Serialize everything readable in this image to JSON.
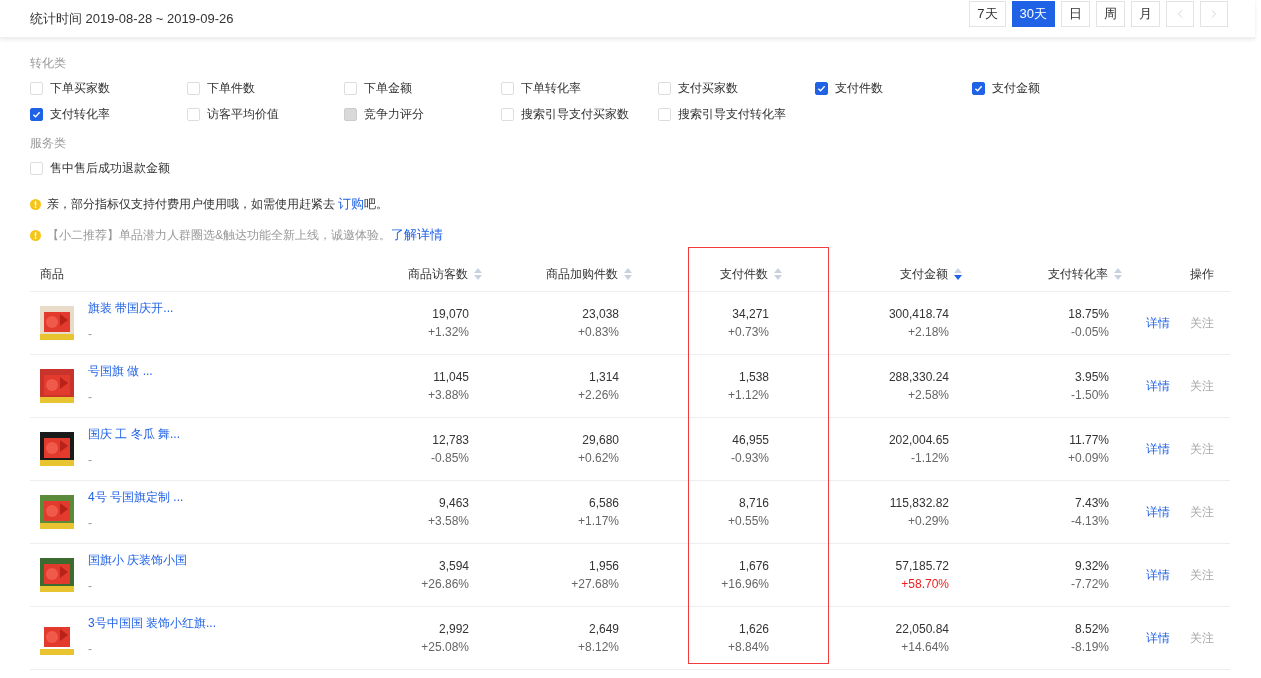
{
  "header": {
    "period_label": "统计时间 2019-08-28 ~ 2019-09-26",
    "ranges": [
      {
        "label": "7天",
        "selected": false
      },
      {
        "label": "30天",
        "selected": true
      },
      {
        "label": "日",
        "selected": false
      },
      {
        "label": "周",
        "selected": false
      },
      {
        "label": "月",
        "selected": false
      }
    ]
  },
  "metric_groups": [
    {
      "title": "转化类",
      "items": [
        {
          "label": "下单买家数",
          "checked": false,
          "disabled": false
        },
        {
          "label": "下单件数",
          "checked": false,
          "disabled": false
        },
        {
          "label": "下单金额",
          "checked": false,
          "disabled": false
        },
        {
          "label": "下单转化率",
          "checked": false,
          "disabled": false
        },
        {
          "label": "支付买家数",
          "checked": false,
          "disabled": false
        },
        {
          "label": "支付件数",
          "checked": true,
          "disabled": false
        },
        {
          "label": "支付金额",
          "checked": true,
          "disabled": false
        },
        {
          "label": "支付转化率",
          "checked": true,
          "disabled": false
        },
        {
          "label": "访客平均价值",
          "checked": false,
          "disabled": false
        },
        {
          "label": "竞争力评分",
          "checked": false,
          "disabled": true
        },
        {
          "label": "搜索引导支付买家数",
          "checked": false,
          "disabled": false
        },
        {
          "label": "搜索引导支付转化率",
          "checked": false,
          "disabled": false
        }
      ]
    },
    {
      "title": "服务类",
      "items": [
        {
          "label": "售中售后成功退款金额",
          "checked": false,
          "disabled": false
        }
      ]
    }
  ],
  "notices": [
    {
      "kind": "notice",
      "text": "亲，部分指标仅支持付费用户使用哦，如需使用赶紧去 ",
      "link": "订购",
      "suffix": "吧。"
    },
    {
      "kind": "tip",
      "text": "【小二推荐】单品潜力人群圈选&触达功能全新上线，诚邀体验。",
      "link": "了解详情"
    }
  ],
  "table": {
    "columns": [
      {
        "label": "商品",
        "sortable": false,
        "highlighted": false
      },
      {
        "label": "商品访客数",
        "sortable": true,
        "sorted_desc": false,
        "highlighted": false
      },
      {
        "label": "商品加购件数",
        "sortable": true,
        "sorted_desc": false,
        "highlighted": false
      },
      {
        "label": "支付件数",
        "sortable": true,
        "sorted_desc": false,
        "highlighted": true
      },
      {
        "label": "支付金额",
        "sortable": true,
        "sorted_desc": true,
        "highlighted": false
      },
      {
        "label": "支付转化率",
        "sortable": true,
        "sorted_desc": false,
        "highlighted": false
      },
      {
        "label": "操作",
        "sortable": false,
        "highlighted": false
      }
    ],
    "rows": [
      {
        "name": "旗装 带国庆开...",
        "sub": "-",
        "metrics": [
          {
            "value": "19,070",
            "change": "+1.32%",
            "alert": false
          },
          {
            "value": "23,038",
            "change": "+0.83%",
            "alert": false
          },
          {
            "value": "34,271",
            "change": "+0.73%",
            "alert": false
          },
          {
            "value": "300,418.74",
            "change": "+2.18%",
            "alert": false
          },
          {
            "value": "18.75%",
            "change": "-0.05%",
            "alert": false
          }
        ],
        "actions": [
          {
            "label": "详情",
            "kind": "link"
          },
          {
            "label": "关注",
            "kind": "muted"
          }
        ]
      },
      {
        "name": "号国旗 做 ...",
        "sub": "-",
        "metrics": [
          {
            "value": "11,045",
            "change": "+3.88%",
            "alert": false
          },
          {
            "value": "1,314",
            "change": "+2.26%",
            "alert": false
          },
          {
            "value": "1,538",
            "change": "+1.12%",
            "alert": false
          },
          {
            "value": "288,330.24",
            "change": "+2.58%",
            "alert": false
          },
          {
            "value": "3.95%",
            "change": "-1.50%",
            "alert": false
          }
        ],
        "actions": [
          {
            "label": "详情",
            "kind": "link"
          },
          {
            "label": "关注",
            "kind": "muted"
          }
        ]
      },
      {
        "name": "国庆 工 冬瓜 舞...",
        "sub": "-",
        "metrics": [
          {
            "value": "12,783",
            "change": "-0.85%",
            "alert": false
          },
          {
            "value": "29,680",
            "change": "+0.62%",
            "alert": false
          },
          {
            "value": "46,955",
            "change": "-0.93%",
            "alert": false
          },
          {
            "value": "202,004.65",
            "change": "-1.12%",
            "alert": false
          },
          {
            "value": "11.77%",
            "change": "+0.09%",
            "alert": false
          }
        ],
        "actions": [
          {
            "label": "详情",
            "kind": "link"
          },
          {
            "label": "关注",
            "kind": "muted"
          }
        ]
      },
      {
        "name": "4号 号国旗定制 ...",
        "sub": "-",
        "metrics": [
          {
            "value": "9,463",
            "change": "+3.58%",
            "alert": false
          },
          {
            "value": "6,586",
            "change": "+1.17%",
            "alert": false
          },
          {
            "value": "8,716",
            "change": "+0.55%",
            "alert": false
          },
          {
            "value": "115,832.82",
            "change": "+0.29%",
            "alert": false
          },
          {
            "value": "7.43%",
            "change": "-4.13%",
            "alert": false
          }
        ],
        "actions": [
          {
            "label": "详情",
            "kind": "link"
          },
          {
            "label": "关注",
            "kind": "muted"
          }
        ]
      },
      {
        "name": "国旗小 庆装饰小国",
        "sub": "-",
        "metrics": [
          {
            "value": "3,594",
            "change": "+26.86%",
            "alert": false
          },
          {
            "value": "1,956",
            "change": "+27.68%",
            "alert": false
          },
          {
            "value": "1,676",
            "change": "+16.96%",
            "alert": false
          },
          {
            "value": "57,185.72",
            "change": "+58.70%",
            "alert": true
          },
          {
            "value": "9.32%",
            "change": "-7.72%",
            "alert": false
          }
        ],
        "actions": [
          {
            "label": "详情",
            "kind": "link"
          },
          {
            "label": "关注",
            "kind": "muted"
          }
        ]
      },
      {
        "name": "3号中国国 装饰小红旗...",
        "sub": "-",
        "metrics": [
          {
            "value": "2,992",
            "change": "+25.08%",
            "alert": false
          },
          {
            "value": "2,649",
            "change": "+8.12%",
            "alert": false
          },
          {
            "value": "1,626",
            "change": "+8.84%",
            "alert": false
          },
          {
            "value": "22,050.84",
            "change": "+14.64%",
            "alert": false
          },
          {
            "value": "8.52%",
            "change": "-8.19%",
            "alert": false
          }
        ],
        "actions": [
          {
            "label": "详情",
            "kind": "link"
          },
          {
            "label": "关注",
            "kind": "muted"
          }
        ]
      }
    ]
  }
}
